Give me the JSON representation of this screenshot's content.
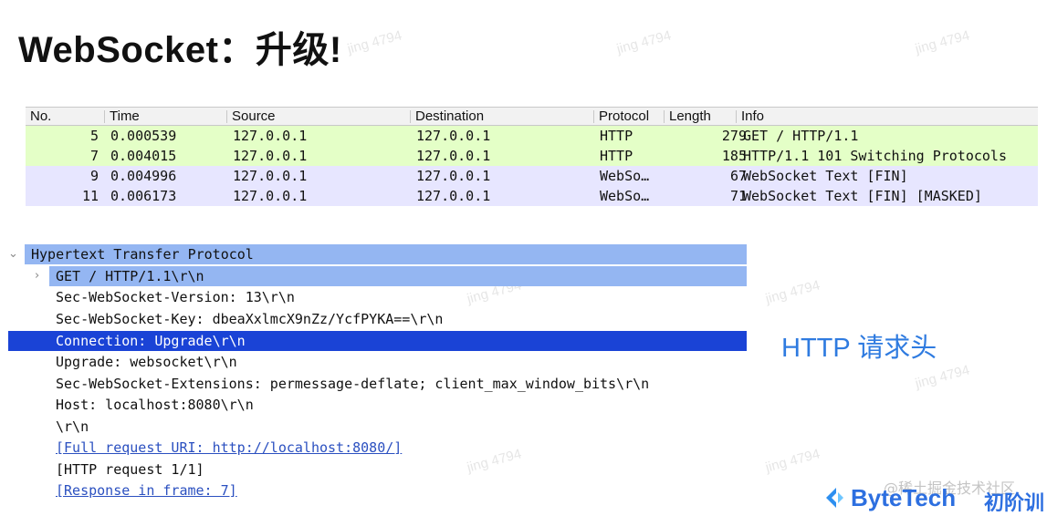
{
  "title": "WebSocket：升级!",
  "packet_list": {
    "columns": [
      "No.",
      "Time",
      "Source",
      "Destination",
      "Protocol",
      "Length",
      "Info"
    ],
    "rows": [
      {
        "no": "5",
        "time": "0.000539",
        "source": "127.0.0.1",
        "destination": "127.0.0.1",
        "protocol": "HTTP",
        "length": "279",
        "info": "GET / HTTP/1.1",
        "color": "#e4ffc7"
      },
      {
        "no": "7",
        "time": "0.004015",
        "source": "127.0.0.1",
        "destination": "127.0.0.1",
        "protocol": "HTTP",
        "length": "185",
        "info": "HTTP/1.1 101 Switching Protocols",
        "color": "#e4ffc7"
      },
      {
        "no": "9",
        "time": "0.004996",
        "source": "127.0.0.1",
        "destination": "127.0.0.1",
        "protocol": "WebSo…",
        "length": "67",
        "info": "WebSocket Text [FIN]",
        "color": "#e7e6ff"
      },
      {
        "no": "11",
        "time": "0.006173",
        "source": "127.0.0.1",
        "destination": "127.0.0.1",
        "protocol": "WebSo…",
        "length": "71",
        "info": "WebSocket Text [FIN] [MASKED]",
        "color": "#e7e6ff"
      }
    ]
  },
  "detail": {
    "root": "Hypertext Transfer Protocol",
    "request_line": "GET / HTTP/1.1\\r\\n",
    "headers": [
      "Sec-WebSocket-Version: 13\\r\\n",
      "Sec-WebSocket-Key: dbeaXxlmcX9nZz/YcfPYKA==\\r\\n",
      "Connection: Upgrade\\r\\n",
      "Upgrade: websocket\\r\\n",
      "Sec-WebSocket-Extensions: permessage-deflate; client_max_window_bits\\r\\n",
      "Host: localhost:8080\\r\\n",
      "\\r\\n"
    ],
    "full_request_uri": "[Full request URI: http://localhost:8080/]",
    "http_request": "[HTTP request 1/1]",
    "response_in_frame": "[Response in frame: 7]"
  },
  "annotation": "HTTP 请求头",
  "brand": {
    "name": "ByteTech",
    "sub": "初阶训"
  },
  "credit": "@稀土掘金技术社区",
  "watermark": "jing 4794",
  "colors": {
    "http_row": "#e4ffc7",
    "websocket_row": "#e7e6ff",
    "selected": "#1a43d6",
    "selected_parent": "#94b6f2",
    "accent": "#2d6fe0"
  }
}
